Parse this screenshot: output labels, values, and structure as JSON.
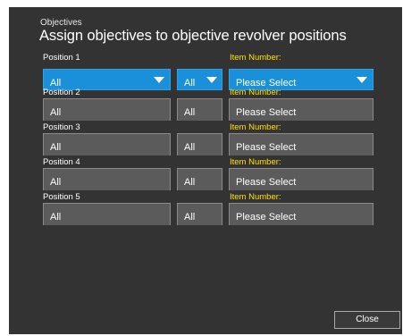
{
  "dialog": {
    "subtitle": "Objectives",
    "title": "Assign objectives to objective revolver positions",
    "item_number_label": "Item Number:",
    "close_label": "Close"
  },
  "positions": [
    {
      "label": "Position 1",
      "type": "All",
      "subtype": "All",
      "item": "Please Select",
      "active": true
    },
    {
      "label": "Position 2",
      "type": "All",
      "subtype": "All",
      "item": "Please Select",
      "active": false
    },
    {
      "label": "Position 3",
      "type": "All",
      "subtype": "All",
      "item": "Please Select",
      "active": false
    },
    {
      "label": "Position 4",
      "type": "All",
      "subtype": "All",
      "item": "Please Select",
      "active": false
    },
    {
      "label": "Position 5",
      "type": "All",
      "subtype": "All",
      "item": "Please Select",
      "active": false
    }
  ],
  "colors": {
    "background": "#333333",
    "selected_dropdown": "#1a8fda",
    "dropdown": "#5b5b5b",
    "item_label": "#ffe000"
  },
  "icons": {
    "dropdown_arrow": "chevron-down-icon"
  }
}
